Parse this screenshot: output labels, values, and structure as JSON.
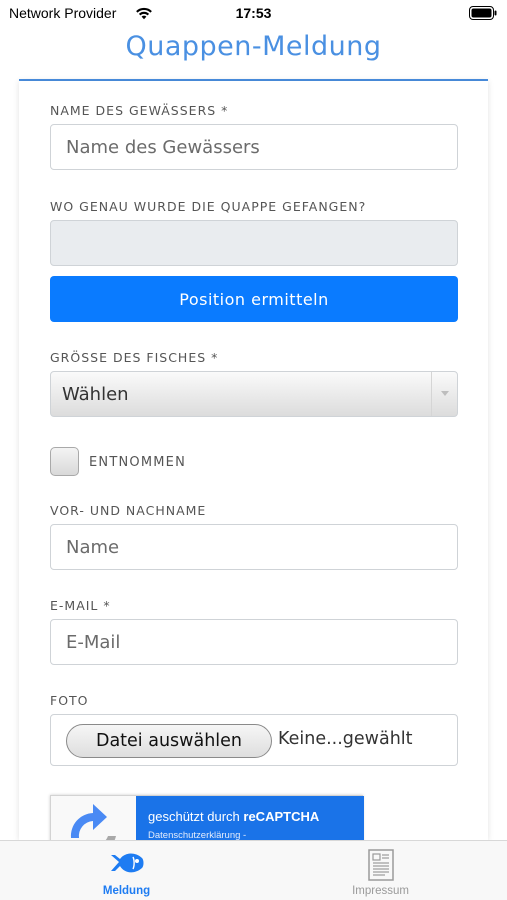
{
  "status_bar": {
    "carrier": "Network Provider",
    "time": "17:53"
  },
  "app": {
    "title": "Quappen-Meldung"
  },
  "form": {
    "water_name": {
      "label": "NAME DES GEWÄSSERS *",
      "placeholder": "Name des Gewässers"
    },
    "location": {
      "label": "WO GENAU WURDE DIE QUAPPE GEFANGEN?",
      "button": "Position ermitteln"
    },
    "fish_size": {
      "label": "GRÖSSE DES FISCHES *",
      "selected": "Wählen"
    },
    "removed": {
      "label": "ENTNOMMEN",
      "checked": false
    },
    "full_name": {
      "label": "VOR- UND NACHNAME",
      "placeholder": "Name"
    },
    "email": {
      "label": "E-MAIL *",
      "placeholder": "E-Mail"
    },
    "photo": {
      "label": "FOTO",
      "button": "Datei auswählen",
      "status": "Keine...gewählt"
    },
    "recaptcha": {
      "protected_prefix": "geschützt durch ",
      "brand": "reCAPTCHA",
      "privacy": "Datenschutzerklärung -"
    }
  },
  "tab_bar": {
    "tabs": [
      {
        "label": "Meldung",
        "icon": "fish-icon",
        "active": true
      },
      {
        "label": "Impressum",
        "icon": "document-icon",
        "active": false
      }
    ]
  },
  "colors": {
    "accent": "#4a90e2",
    "button": "#0a7bff",
    "tab_active": "#1e7cf2",
    "recaptcha": "#1a73e8"
  }
}
